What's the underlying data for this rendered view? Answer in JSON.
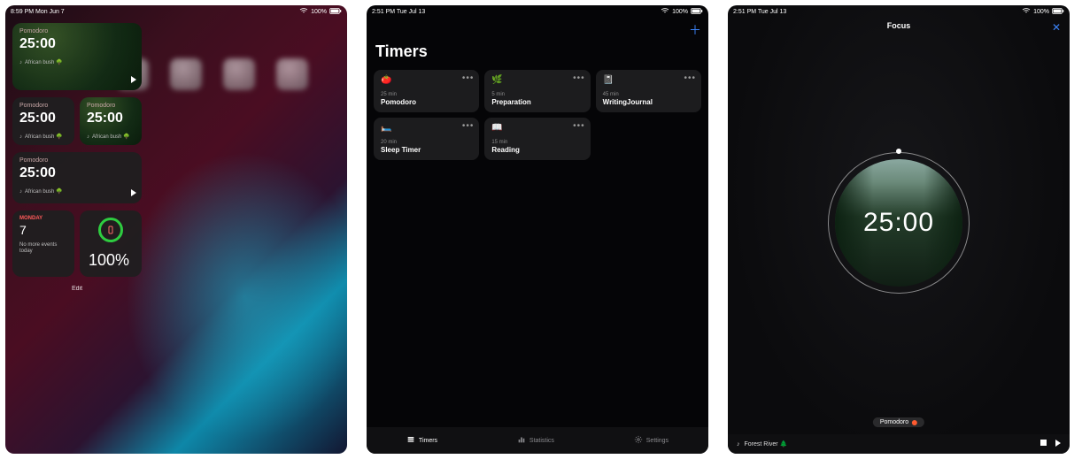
{
  "statusbar": {
    "home_time": "8:59 PM  Mon Jun 7",
    "timers_time": "2:51 PM  Tue Jul 13",
    "focus_time": "2:51 PM  Tue Jul 13",
    "battery": "100%"
  },
  "home": {
    "widgets": {
      "w1": {
        "label": "Pomodoro",
        "time": "25:00",
        "track": "African bush 🌳"
      },
      "w2": {
        "label": "Pomodoro",
        "time": "25:00",
        "track": "African bush 🌳"
      },
      "w3": {
        "label": "Pomodoro",
        "time": "25:00",
        "track": "African bush 🌳"
      },
      "w4": {
        "label": "Pomodoro",
        "time": "25:00",
        "track": "African bush 🌳"
      }
    },
    "calendar": {
      "day": "MONDAY",
      "date": "7",
      "noevents": "No more events today"
    },
    "battery_pct": "100%",
    "edit": "Edit"
  },
  "timers": {
    "title": "Timers",
    "cards": [
      {
        "emoji": "🍅",
        "duration": "25 min",
        "name": "Pomodoro"
      },
      {
        "emoji": "🌿",
        "duration": "5 min",
        "name": "Preparation"
      },
      {
        "emoji": "📓",
        "duration": "45 min",
        "name": "WritingJournal"
      },
      {
        "emoji": "🛏️",
        "duration": "20 min",
        "name": "Sleep Timer"
      },
      {
        "emoji": "📖",
        "duration": "15 min",
        "name": "Reading"
      }
    ],
    "tabs": {
      "timers": "Timers",
      "stats": "Statistics",
      "settings": "Settings"
    }
  },
  "focus": {
    "title": "Focus",
    "time": "25:00",
    "pill": "Pomodoro",
    "track": "Forest River 🌲"
  }
}
